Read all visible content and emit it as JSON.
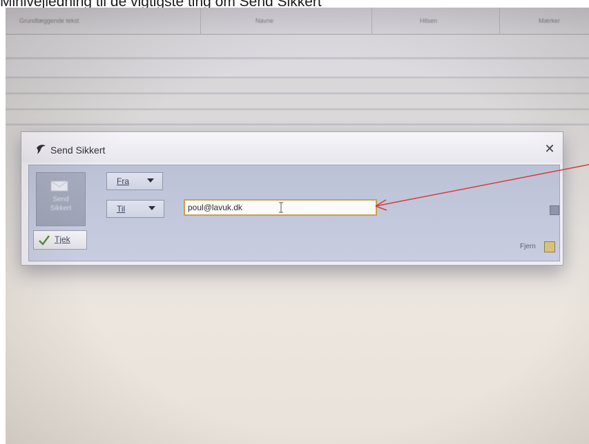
{
  "caption": "Minivejledning til de vigtigste ting om Send Sikkert",
  "table_header": {
    "columns": [
      "Grundlæggende tekst",
      "Navne",
      "Hilsen",
      "Mærker"
    ]
  },
  "dialog": {
    "title": "Send Sikkert",
    "close_label": "✕",
    "send_button_label": "Send\nSikkert",
    "tjek_label": "Tjek",
    "fra_label": "Fra",
    "til_label": "Til",
    "to_value": "poul@lavuk.dk",
    "fjern_label": "Fjern"
  },
  "colors": {
    "arrow": "#d83a3a",
    "input_border": "#c9a24a",
    "dialog_body": "#c2c7da"
  },
  "icons": {
    "title_icon": "feather-icon",
    "send_icon": "envelope-icon",
    "tjek_icon": "checkmark-icon",
    "close_icon": "close-icon",
    "dropdown_icon": "caret-down-icon",
    "text_cursor_icon": "text-cursor-icon"
  }
}
